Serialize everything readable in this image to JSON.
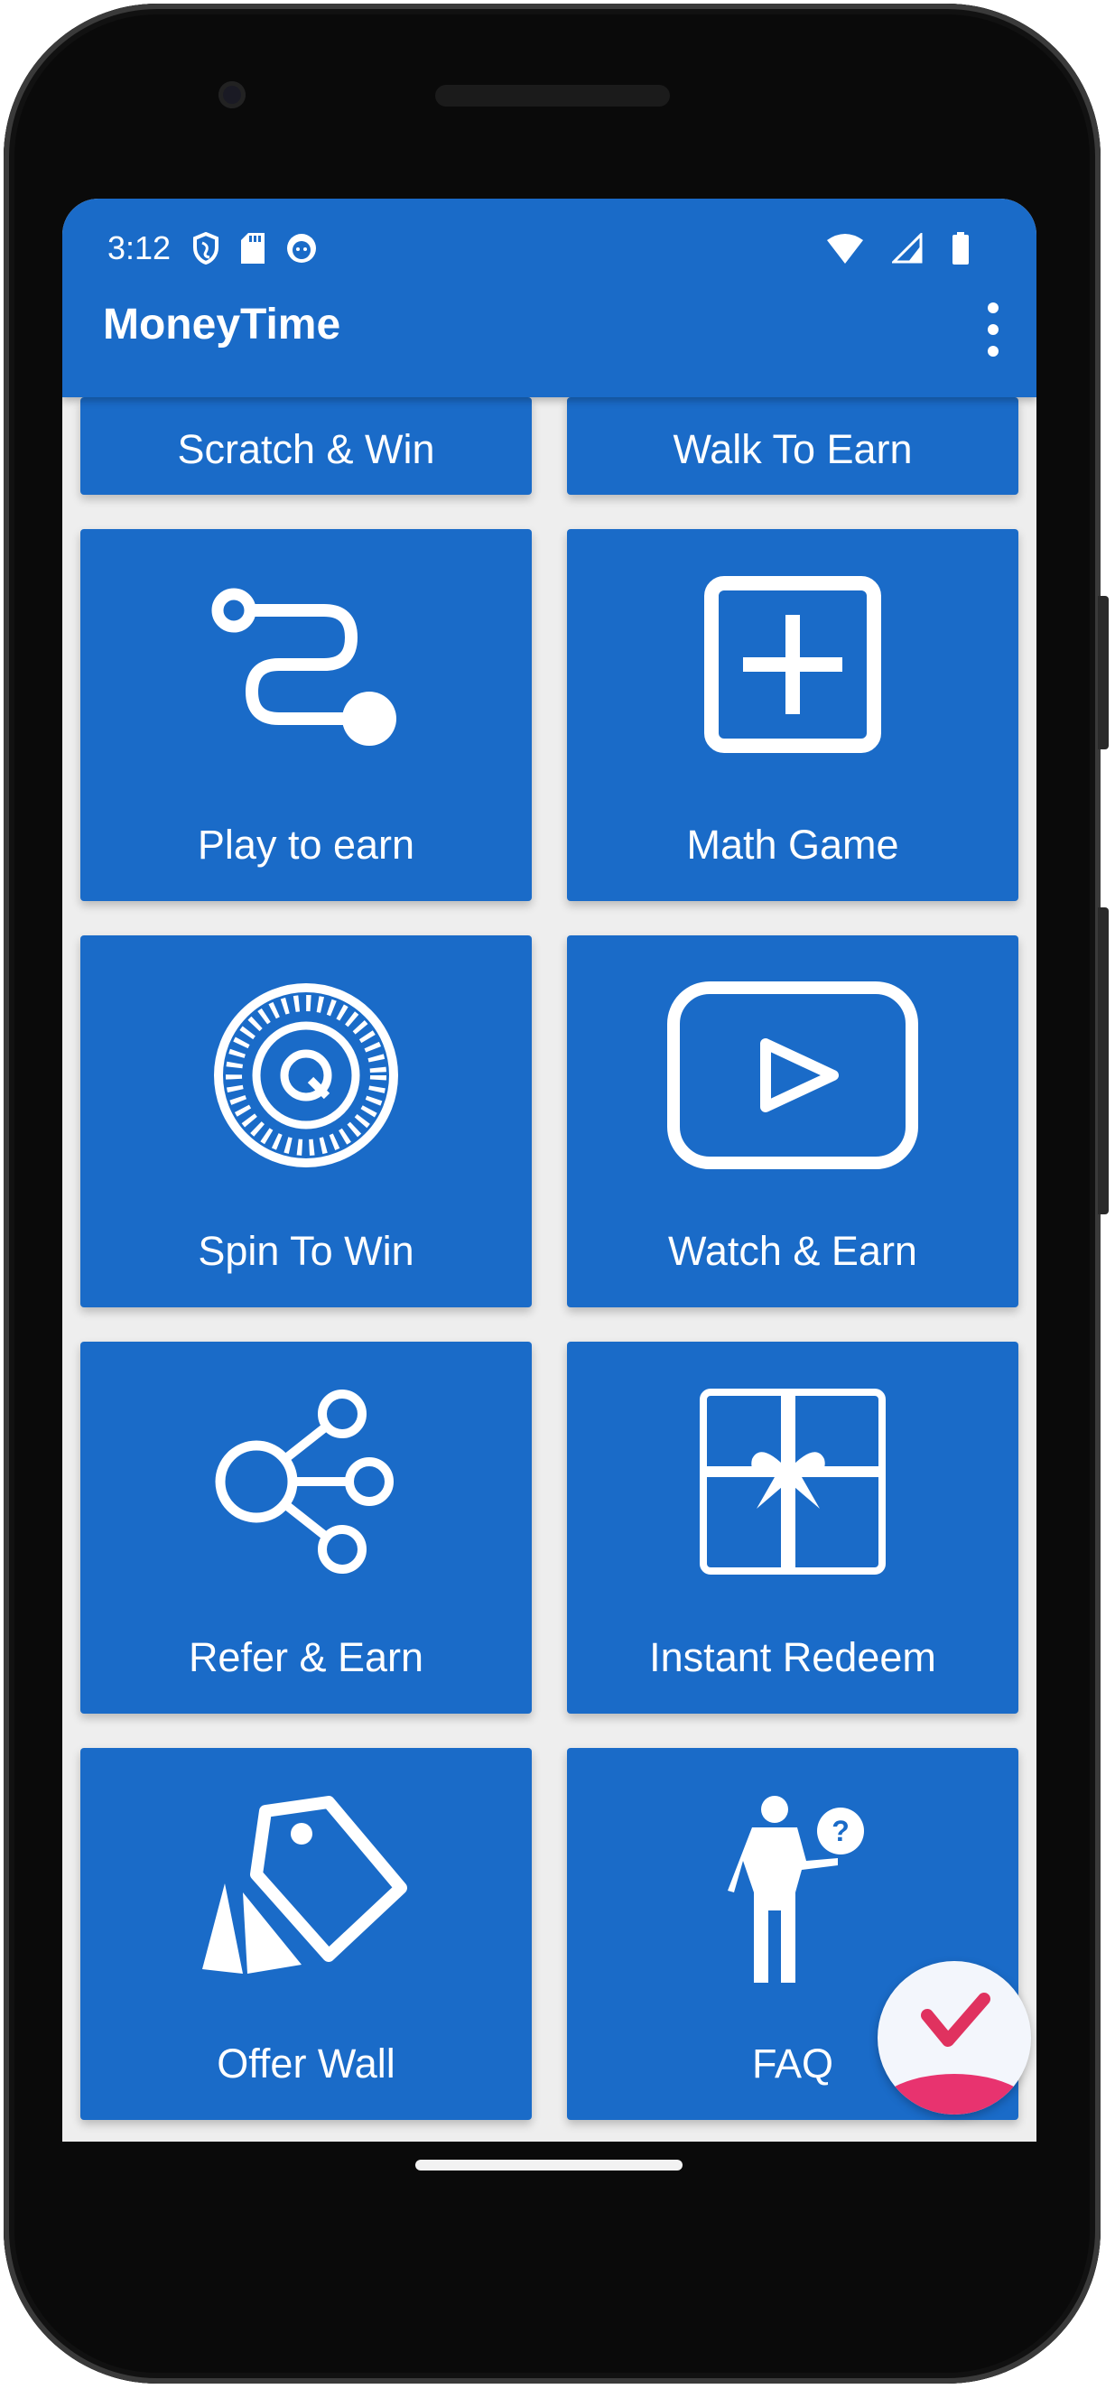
{
  "status_bar": {
    "time": "3:12",
    "icons": [
      "shield-icon",
      "sd-card-icon",
      "cat-icon",
      "wifi-icon",
      "signal-icon",
      "battery-icon"
    ]
  },
  "app_bar": {
    "title": "MoneyTime",
    "menu_icon": "more-vert-icon"
  },
  "tiles": [
    {
      "label": "Scratch & Win",
      "icon": "none"
    },
    {
      "label": "Walk To Earn",
      "icon": "none"
    },
    {
      "label": "Play to earn",
      "icon": "route-icon"
    },
    {
      "label": "Math Game",
      "icon": "plus-box-icon"
    },
    {
      "label": "Spin To Win",
      "icon": "dial-icon"
    },
    {
      "label": "Watch & Earn",
      "icon": "play-icon"
    },
    {
      "label": "Refer & Earn",
      "icon": "share-icon"
    },
    {
      "label": "Instant Redeem",
      "icon": "gift-icon"
    },
    {
      "label": "Offer Wall",
      "icon": "tag-icon"
    },
    {
      "label": "FAQ",
      "icon": "faq-person-icon"
    }
  ],
  "colors": {
    "primary": "#1a6bc8",
    "background": "#eeeeee",
    "accent": "#e8336f"
  }
}
